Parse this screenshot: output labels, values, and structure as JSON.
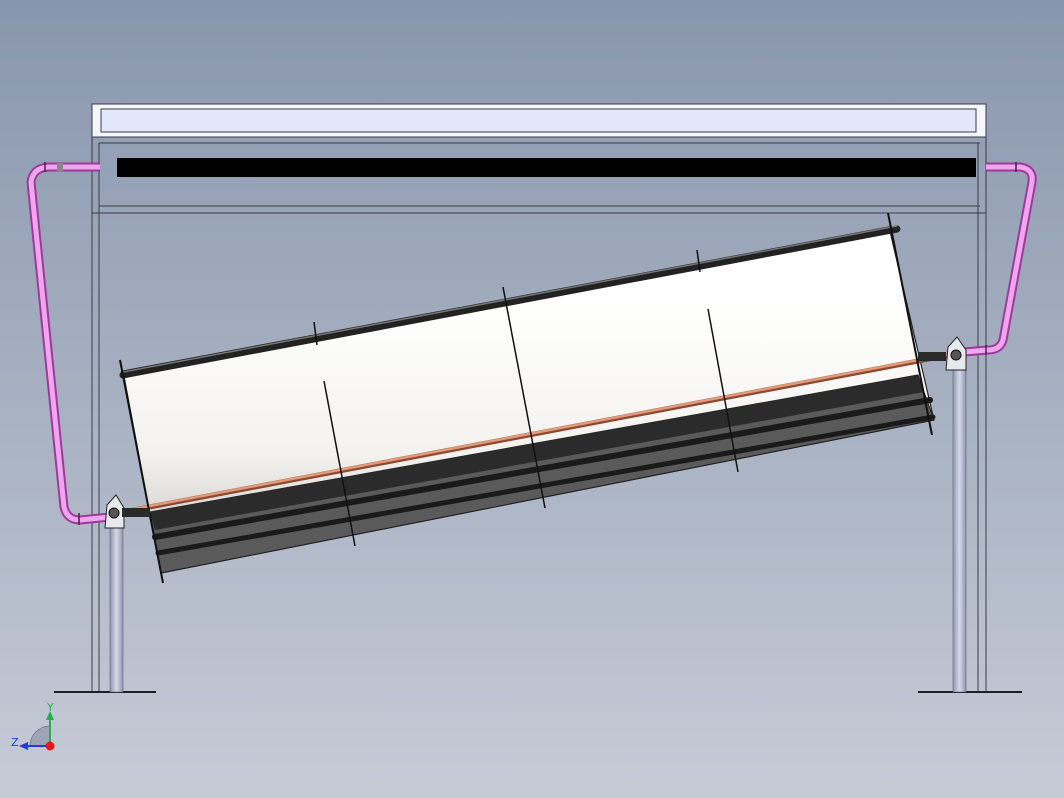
{
  "viewport": {
    "background_top": "#8896ad",
    "background_bottom": "#c6cbd6"
  },
  "model": {
    "frame_color": "#f4f6fb",
    "frame_line": "#3a3d48",
    "upper_rail_fill": "#e4e7fb",
    "absorber_fill": "#000000",
    "pipe_color": "#e27ce0",
    "copper_tube": "#d9805e",
    "reflector_light": "#ffffff",
    "reflector_shade": "#d9d9d9",
    "frame_plate_dark": "#2b2b2b",
    "support_post": "#b7bfd6"
  },
  "triad": {
    "x_label": "Z",
    "y_label": "Y",
    "y_axis_color": "#22b14c",
    "z_axis_color": "#1f3fd6",
    "origin_color": "#e01b1b"
  }
}
